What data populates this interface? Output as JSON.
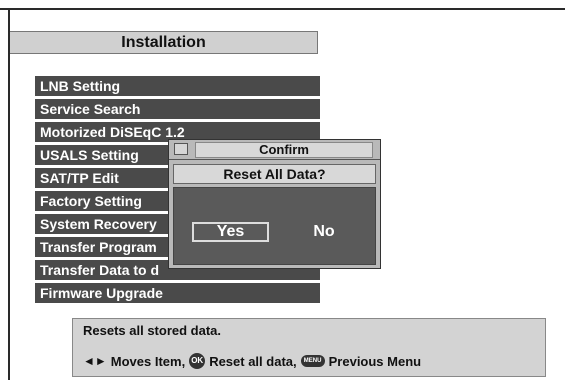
{
  "header": {
    "title": "Installation"
  },
  "menu": {
    "items": [
      "LNB Setting",
      "Service Search",
      "Motorized DiSEqC 1.2",
      "USALS Setting",
      "SAT/TP Edit",
      "Factory Setting",
      "System Recovery",
      "Transfer Program",
      "Transfer Data to d",
      "Firmware Upgrade"
    ]
  },
  "dialog": {
    "title": "Confirm",
    "question": "Reset All Data?",
    "yes_label": "Yes",
    "no_label": "No",
    "selected": "Yes"
  },
  "help": {
    "description": "Resets all stored data.",
    "moves_icon": "left-right-arrow-icon",
    "moves_label": "Moves Item,",
    "ok_icon_text": "OK",
    "ok_label": "Reset all data,",
    "menu_icon_text": "MENU",
    "menu_label": "Previous Menu"
  },
  "colors": {
    "menu_bg": "#4a4a4a",
    "title_bg": "#d0d0d0",
    "dialog_bg": "#b9b9b9",
    "dialog_body_bg": "#5a5a5a",
    "help_bg": "#d3d3d3"
  }
}
